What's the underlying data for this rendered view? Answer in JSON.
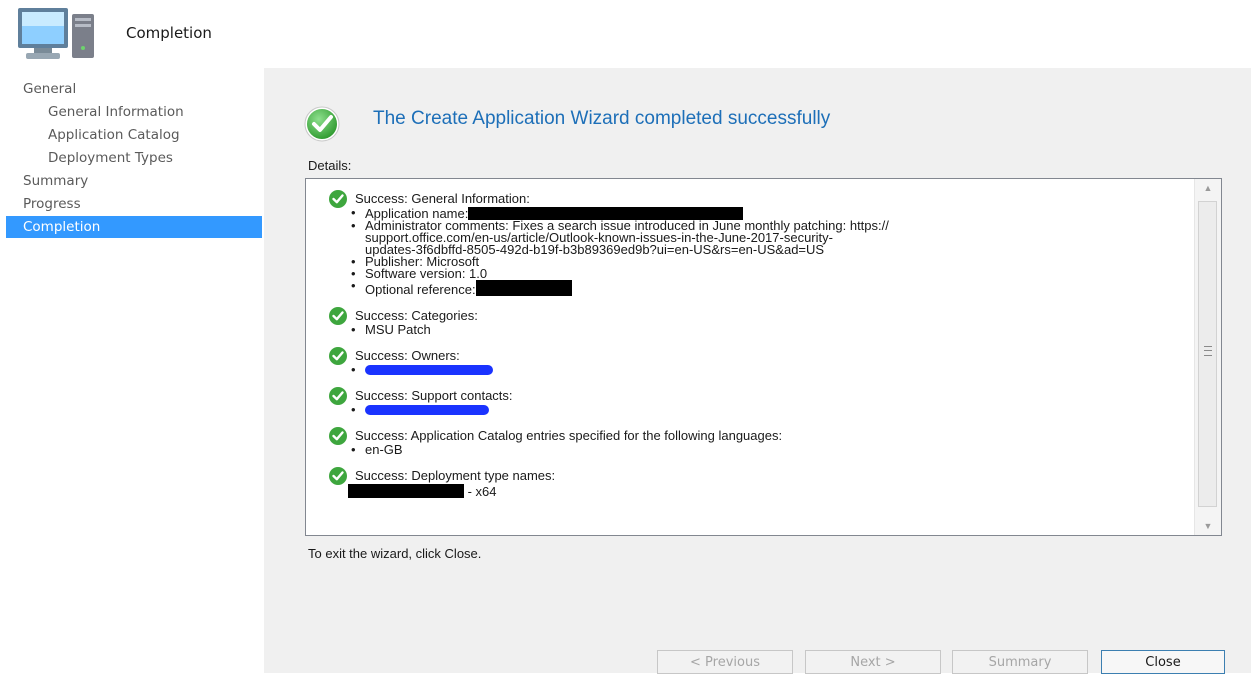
{
  "header": {
    "title": "Completion",
    "icon": "computer-icon"
  },
  "nav": {
    "items": [
      {
        "label": "General",
        "level": 1,
        "selected": false
      },
      {
        "label": "General Information",
        "level": 2,
        "selected": false
      },
      {
        "label": "Application Catalog",
        "level": 2,
        "selected": false
      },
      {
        "label": "Deployment Types",
        "level": 2,
        "selected": false
      },
      {
        "label": "Summary",
        "level": 1,
        "selected": false
      },
      {
        "label": "Progress",
        "level": 1,
        "selected": false
      },
      {
        "label": "Completion",
        "level": 1,
        "selected": true
      }
    ]
  },
  "main": {
    "title": "The Create Application Wizard completed successfully",
    "details_label": "Details:",
    "exit_text": "To exit the wizard, click Close.",
    "sections": {
      "general": {
        "heading": "Success: General Information:",
        "app_name_label": "Application name:",
        "admin_comments_1": "Administrator comments: Fixes a search issue introduced in June monthly patching: https://",
        "admin_comments_2": "support.office.com/en-us/article/Outlook-known-issues-in-the-June-2017-security-",
        "admin_comments_3": "updates-3f6dbffd-8505-492d-b19f-b3b89369ed9b?ui=en-US&rs=en-US&ad=US",
        "publisher": "Publisher: Microsoft",
        "software_version": "Software version: 1.0",
        "optional_reference_label": "Optional reference:"
      },
      "categories": {
        "heading": "Success: Categories:",
        "item": "MSU Patch"
      },
      "owners": {
        "heading": "Success: Owners:"
      },
      "support": {
        "heading": "Success: Support contacts:"
      },
      "catalog": {
        "heading": "Success: Application Catalog entries specified for the following languages:",
        "item": "en-GB"
      },
      "deployment": {
        "heading": "Success: Deployment type names:",
        "item_suffix": " - x64"
      }
    },
    "bullet": "•"
  },
  "buttons": {
    "previous": "< Previous",
    "next": "Next >",
    "summary": "Summary",
    "close": "Close"
  },
  "colors": {
    "selection": "#3399ff",
    "title": "#1d6fb8",
    "success_green": "#3ea63e",
    "redaction_black": "#000000",
    "redaction_blue": "#1a33ff"
  }
}
